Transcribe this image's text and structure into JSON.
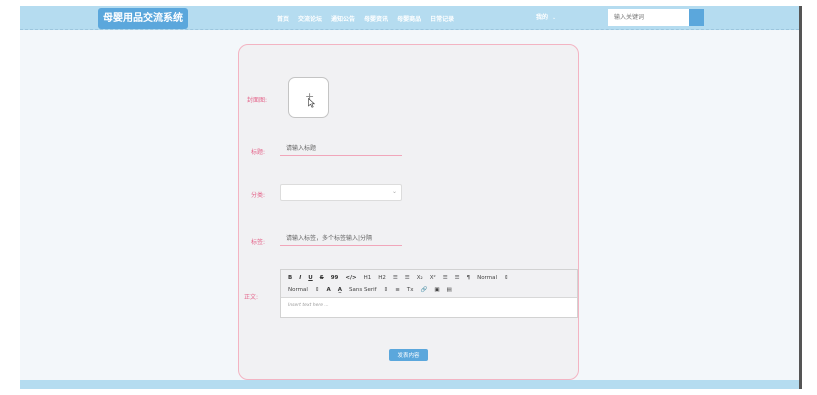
{
  "header": {
    "brand": "母婴用品交流系统",
    "nav": [
      "首页",
      "交流论坛",
      "通知公告",
      "母婴资讯",
      "母婴商品",
      "日常记录"
    ],
    "user_menu": "我的",
    "search_placeholder": "输入关键词"
  },
  "form": {
    "cover_label": "封面图:",
    "title_label": "标题:",
    "title_placeholder": "请输入标题",
    "category_label": "分类:",
    "category_value": "",
    "tags_label": "标签:",
    "tags_placeholder": "请输入标签，多个标签输入|分隔",
    "content_label": "正文:",
    "editor_toolbar_row1": [
      "B",
      "I",
      "U",
      "S",
      "99",
      "</>",
      "H1",
      "H2",
      "☰",
      "☰",
      "X₂",
      "X²",
      "☰",
      "☰",
      "¶",
      "Normal",
      "⇕"
    ],
    "editor_toolbar_row2": [
      "Normal",
      "⇕",
      "A",
      "A̲",
      "Sans Serif",
      "⇕",
      "≡",
      "Tx",
      "🔗",
      "▣",
      "▤"
    ],
    "editor_placeholder": "Insert text here ...",
    "submit_label": "发表内容"
  },
  "colors": {
    "nav_bg": "#b5dcf0",
    "accent": "#5ba7dc",
    "label_pink": "#e4648a",
    "card_border": "#f3b4c2"
  }
}
